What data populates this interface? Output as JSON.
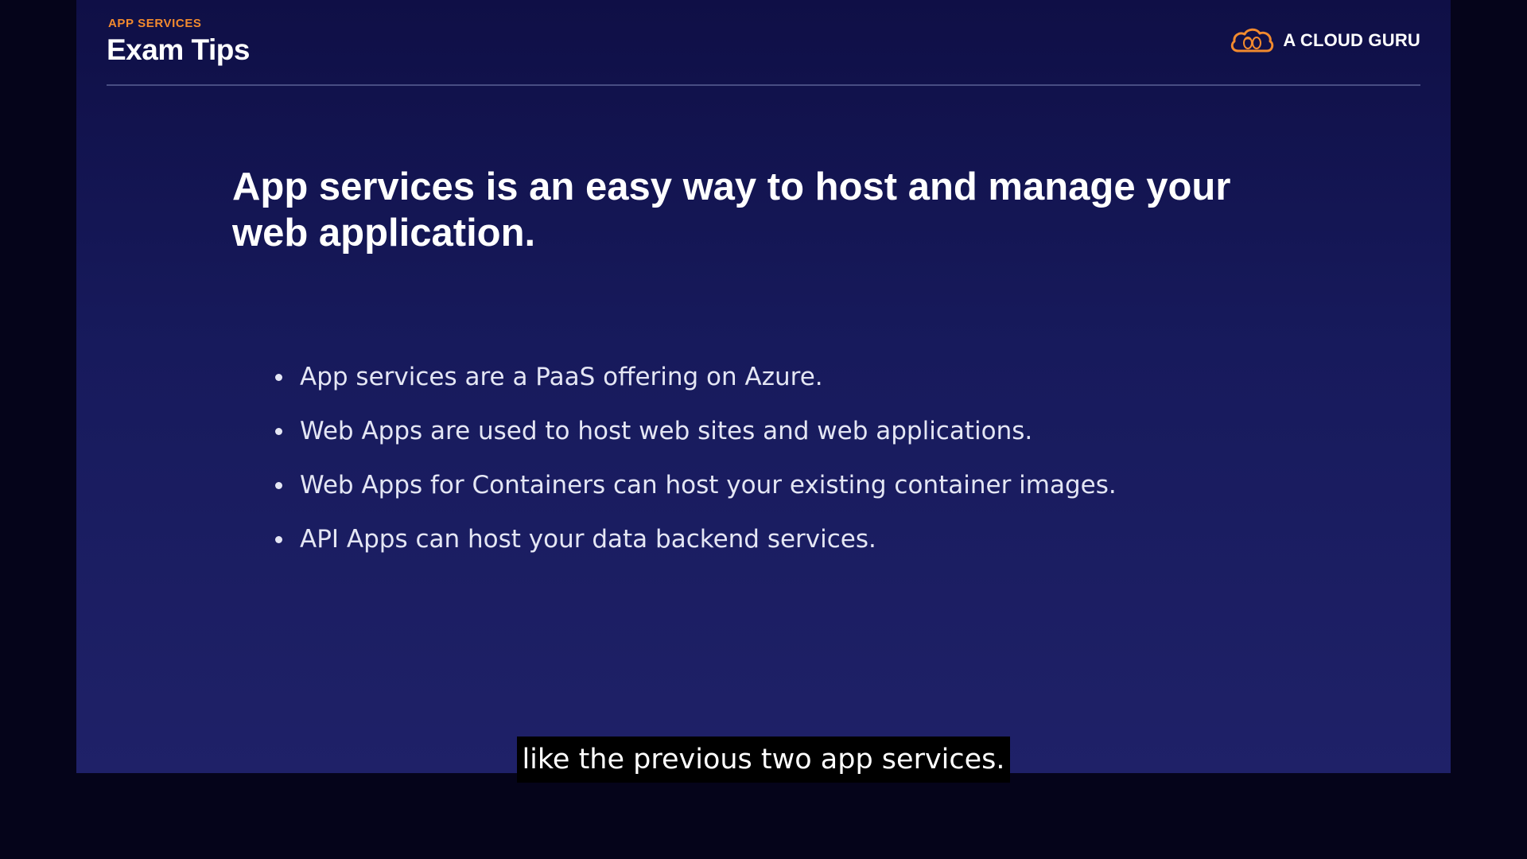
{
  "slide": {
    "eyebrow": "APP SERVICES",
    "title": "Exam Tips",
    "brand_name": "A CLOUD GURU",
    "headline": "App services is an easy way to host and manage your web application.",
    "bullets": [
      "App services are a PaaS offering on Azure.",
      "Web Apps are used to host web sites and web applications.",
      "Web Apps for Containers can host your existing container images.",
      "API Apps can host your data backend services."
    ]
  },
  "caption": {
    "text": "like the previous two app services."
  },
  "colors": {
    "accent": "#f28a2e",
    "background_top": "#0f0f46",
    "background_bottom": "#1f2168",
    "letterbox": "#05041a",
    "text": "#ffffff"
  },
  "icons": {
    "brand_logo": "cloud-logo-icon"
  }
}
